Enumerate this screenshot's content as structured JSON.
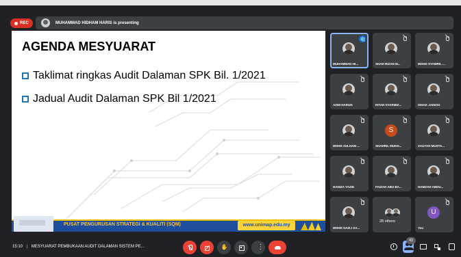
{
  "topbar": {
    "record_label": "REC",
    "presenting_text": "MUHAMMAD HIDHAM HARIS is presenting"
  },
  "slide": {
    "title": "AGENDA MESYUARAT",
    "bullets": [
      "Taklimat ringkas Audit Dalaman SPK Bil. 1/2021",
      "Jadual Audit Dalaman SPK Bil 1/2021"
    ],
    "footer_text": "PUSAT PENGURUSAN STRATEGI & KUALITI (SQM)",
    "footer_url": "www.unimap.edu.my",
    "bullet_color": "#1f77b4",
    "footer_color": "#1f4e9c",
    "footer_accent": "#ffd43b"
  },
  "participants": [
    {
      "name": "MUHAMMAD HI...",
      "speaking": true
    },
    {
      "name": "SHAH RIZAN M...",
      "muted": true
    },
    {
      "name": "MOHD SYAMRIL ...",
      "muted": true
    },
    {
      "name": "AZMI HARUN",
      "muted": true
    },
    {
      "name": "INTAN SYARMIZ...",
      "muted": true
    },
    {
      "name": "ISHAK JAINOO",
      "muted": true
    },
    {
      "name": "MOHD ZULHAM ...",
      "muted": true
    },
    {
      "name": "SHAHRIL MUKH...",
      "muted": true,
      "letter": "S",
      "letter_color": "#c74b1b"
    },
    {
      "name": "ZAUYAH MUSTA...",
      "muted": true
    },
    {
      "name": "HANIZA YAZID",
      "muted": true
    },
    {
      "name": "FAIZAH ABU BA...",
      "muted": true
    },
    {
      "name": "HAMZAH ABDU...",
      "muted": true
    },
    {
      "name": "MOHD SAZLI SA...",
      "muted": true
    },
    {
      "others_label": "28 others"
    },
    {
      "name": "You",
      "muted": true,
      "letter": "U",
      "letter_color": "#7e57c2"
    }
  ],
  "bottombar": {
    "time": "15:10",
    "meeting_title": "MESYUARAT PEMBUKAAN AUDIT DALAMAN SISTEM PE...",
    "people_count": "43"
  },
  "colors": {
    "background": "#202124",
    "tile": "#3c4043",
    "accent_blue": "#8ab4f8",
    "danger": "#ea4335"
  }
}
